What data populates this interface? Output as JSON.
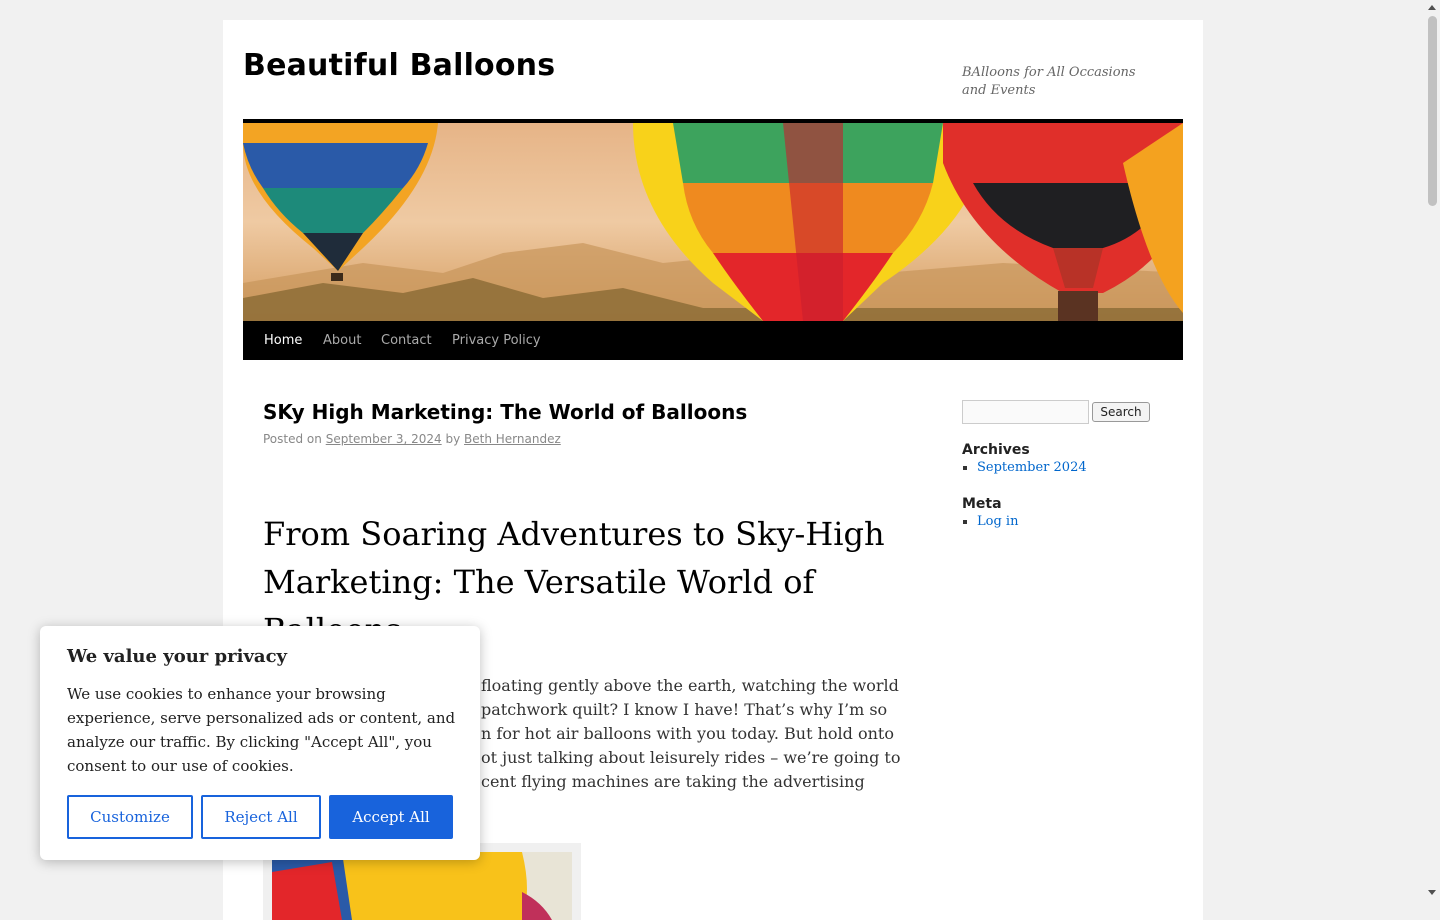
{
  "site": {
    "title": "Beautiful Balloons",
    "description": "BAlloons for All Occasions and Events"
  },
  "nav": {
    "items": [
      {
        "label": "Home",
        "active": true
      },
      {
        "label": "About",
        "active": false
      },
      {
        "label": "Contact",
        "active": false
      },
      {
        "label": "Privacy Policy",
        "active": false
      }
    ]
  },
  "post": {
    "title": "SKy High Marketing: The World of Balloons",
    "meta_prefix": "Posted on",
    "date": "September 3, 2024",
    "by": "by",
    "author": "Beth Hernandez",
    "headline": "From Soaring Adventures to Sky-High Marketing: The Versatile World of Balloons",
    "body_lines": [
      "floating gently above the earth, watching the world",
      "patchwork quilt? I know I have! That’s why I’m so",
      "n for hot air balloons with you today. But hold onto",
      "ot just talking about leisurely rides – we’re going to",
      "cent flying machines are taking the advertising"
    ]
  },
  "sidebar": {
    "search_button": "Search",
    "search_value": "",
    "archives_title": "Archives",
    "archives": [
      "September 2024"
    ],
    "meta_title": "Meta",
    "meta": [
      "Log in"
    ]
  },
  "cookie": {
    "title": "We value your privacy",
    "text": "We use cookies to enhance your browsing experience, serve personalized ads or content, and analyze our traffic. By clicking \"Accept All\", you consent to our use of cookies.",
    "customize": "Customize",
    "reject": "Reject All",
    "accept": "Accept All"
  },
  "colors": {
    "cookie_accent": "#1863dc",
    "link": "#0066cc",
    "nav_bg": "#000000"
  }
}
